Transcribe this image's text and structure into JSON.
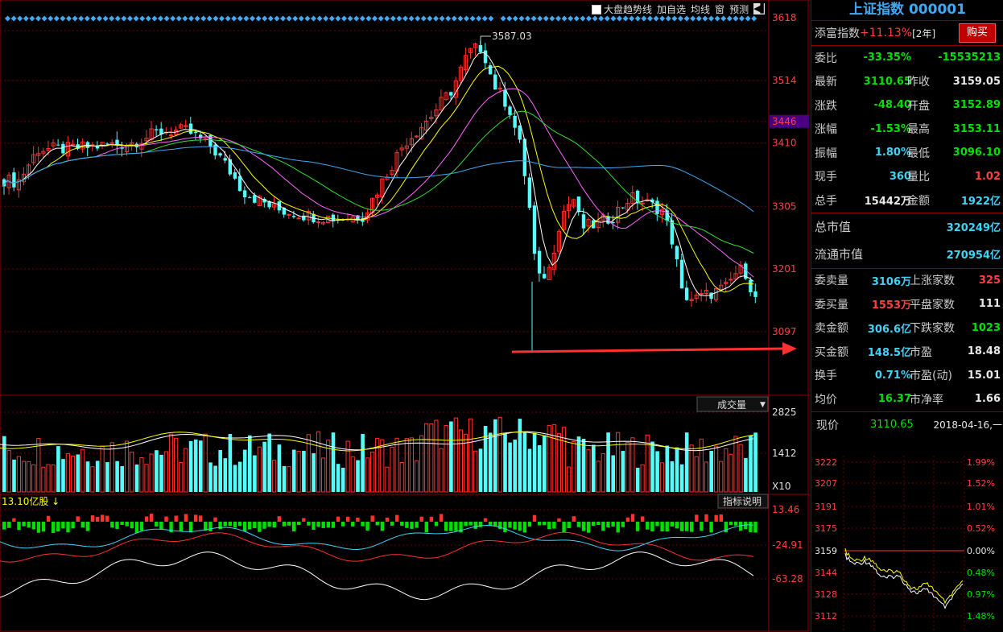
{
  "toolbar": {
    "trend_label": "大盘趋势线",
    "add_fav": "加自选",
    "ma_line": "均线",
    "window": "窗",
    "forecast": "预测",
    "arrow_btn": "◀▌"
  },
  "panel": {
    "title": "上证指数 000001",
    "tianfu_label": "添富指数",
    "tianfu_value": "+11.13%",
    "tianfu_period": "[2年]",
    "buy_label": "购买",
    "rows": [
      {
        "l1": "委比",
        "v1": "-33.35%",
        "c1": "green",
        "l2": "",
        "v2": "-15535213",
        "c2": "green"
      },
      {
        "l1": "最新",
        "v1": "3110.65",
        "c1": "green",
        "l2": "昨收",
        "v2": "3159.05",
        "c2": "white"
      },
      {
        "l1": "涨跌",
        "v1": "-48.40",
        "c1": "green",
        "l2": "开盘",
        "v2": "3152.89",
        "c2": "green"
      },
      {
        "l1": "涨幅",
        "v1": "-1.53%",
        "c1": "green",
        "l2": "最高",
        "v2": "3153.11",
        "c2": "green"
      },
      {
        "l1": "振幅",
        "v1": "1.80%",
        "c1": "cyan",
        "l2": "最低",
        "v2": "3096.10",
        "c2": "green"
      },
      {
        "l1": "现手",
        "v1": "360",
        "c1": "cyan",
        "l2": "量比",
        "v2": "1.02",
        "c2": "red"
      },
      {
        "l1": "总手",
        "v1": "15442万",
        "c1": "white",
        "l2": "金额",
        "v2": "1922亿",
        "c2": "cyan"
      }
    ],
    "cap_rows": [
      {
        "l": "总市值",
        "v": "320249亿"
      },
      {
        "l": "流通市值",
        "v": "270954亿"
      }
    ],
    "order_rows": [
      {
        "l1": "委卖量",
        "v1": "3106万",
        "c1": "cyan",
        "l2": "上涨家数",
        "v2": "325",
        "c2": "red"
      },
      {
        "l1": "委买量",
        "v1": "1553万",
        "c1": "red",
        "l2": "平盘家数",
        "v2": "111",
        "c2": "white"
      },
      {
        "l1": "卖金额",
        "v1": "306.6亿",
        "c1": "cyan",
        "l2": "下跌家数",
        "v2": "1023",
        "c2": "green"
      },
      {
        "l1": "买金额",
        "v1": "148.5亿",
        "c1": "cyan",
        "l2": "市盈",
        "v2": "18.48",
        "c2": "white"
      },
      {
        "l1": "换手",
        "v1": "0.71%",
        "c1": "cyan",
        "l2": "市盈(动)",
        "v2": "15.01",
        "c2": "white"
      },
      {
        "l1": "均价",
        "v1": "16.37",
        "c1": "green",
        "l2": "市净率",
        "v2": "1.66",
        "c2": "white"
      }
    ],
    "now_label": "现价",
    "now_value": "3110.65",
    "now_date": "2018-04-16,一",
    "mini_left": [
      "3222",
      "3207",
      "3191",
      "3175",
      "3159",
      "3144",
      "3128",
      "3112"
    ],
    "mini_right": [
      "1.99%",
      "1.52%",
      "1.01%",
      "0.52%",
      "0.00%",
      "0.48%",
      "0.97%",
      "1.48%"
    ]
  },
  "chart_data": [
    {
      "type": "candlestick",
      "y_ticks": [
        "3618",
        "3514",
        "3446",
        "3410",
        "3305",
        "3201",
        "3097"
      ],
      "ylim": [
        3060,
        3618
      ],
      "highlight_tick": "3446",
      "annotations": [
        {
          "text": "3587.03"
        }
      ]
    },
    {
      "type": "bar",
      "title": "成交量",
      "y_ticks": [
        "2825",
        "1412"
      ],
      "unit": "X10"
    },
    {
      "type": "line",
      "header": "13.10亿股",
      "button": "指标说明",
      "y_ticks": [
        "13.46",
        "-24.91",
        "-63.28"
      ]
    }
  ]
}
